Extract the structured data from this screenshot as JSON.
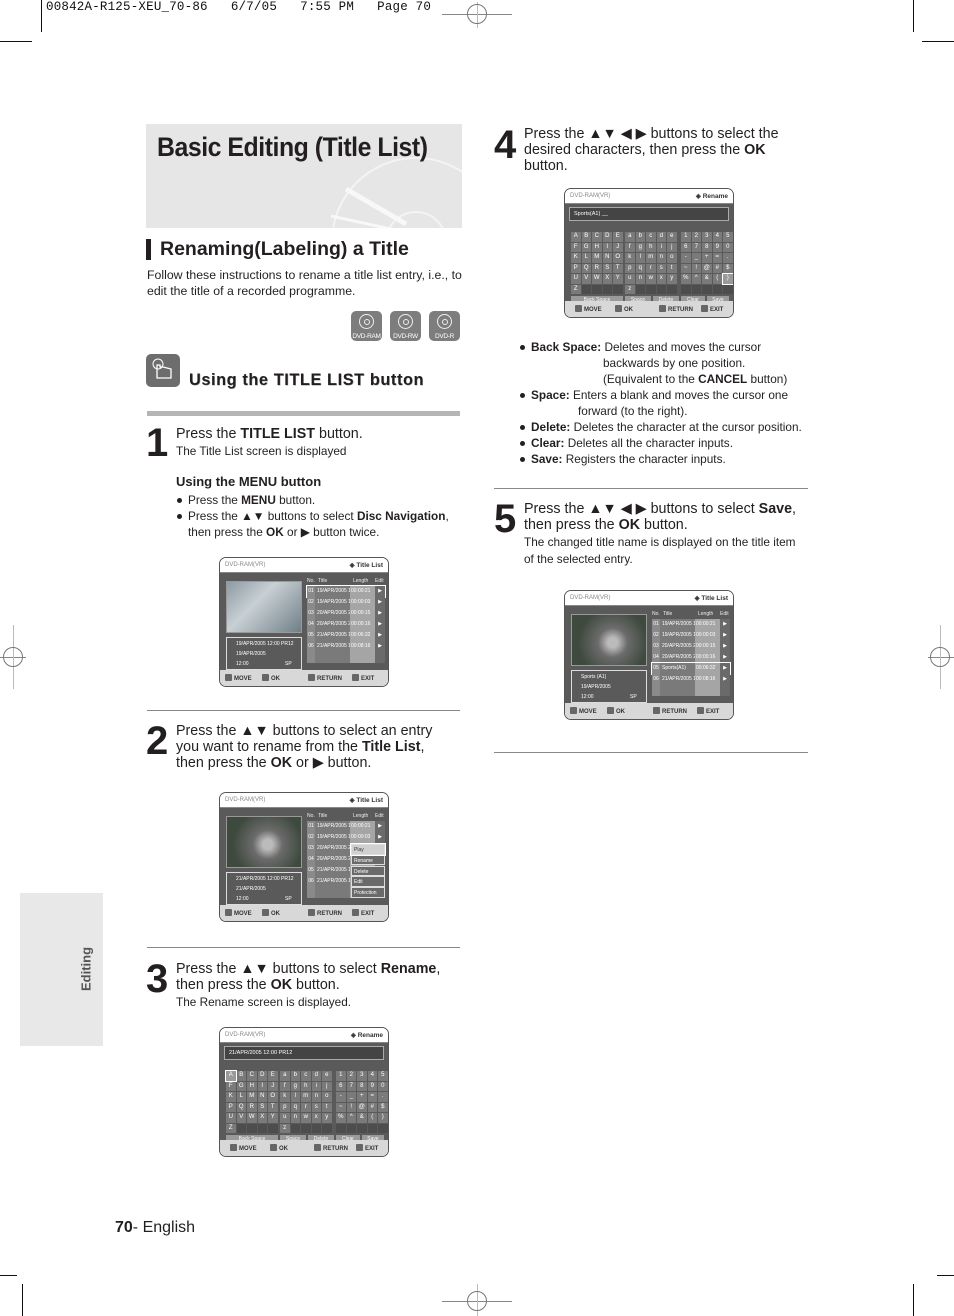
{
  "print_header": "00842A-R125-XEU_70-86   6/7/05   7:55 PM   Page 70",
  "page_title": "Basic Editing (Title List)",
  "section_title": "Renaming(Labeling) a Title",
  "intro": "Follow these instructions to rename a title list entry, i.e., to edit the title of a recorded programme.",
  "disc_types": [
    "DVD-RAM",
    "DVD-RW",
    "DVD-R"
  ],
  "using_header": "Using the TITLE LIST button",
  "side_tab": "Editing",
  "page_number": "70",
  "page_lang": "- English",
  "steps": [
    {
      "num": "1",
      "main_pre": "Press the ",
      "main_bold": "TITLE LIST",
      "main_post": " button.",
      "sub": "The Title List screen is displayed",
      "menu_header": "Using the MENU button",
      "bullets": [
        {
          "pre": "Press the ",
          "bold": "MENU",
          "post": " button."
        },
        {
          "pre": "Press the ▲▼ buttons to select ",
          "bold": "Disc Navigation",
          "post": ",",
          "line2_pre": "then press the ",
          "line2_bold": "OK",
          "line2_post": " or ▶ button twice."
        }
      ]
    },
    {
      "num": "2",
      "l1": "Press the ▲▼ buttons to select an entry",
      "l2_pre": "you want to rename from the ",
      "l2_bold": "Title List",
      "l2_post": ",",
      "l3_pre": "then press the ",
      "l3_bold": "OK",
      "l3_post": " or ▶ button."
    },
    {
      "num": "3",
      "l1_pre": "Press the ▲▼ buttons to select ",
      "l1_bold": "Rename",
      "l1_post": ",",
      "l2_pre": "then press the ",
      "l2_bold": "OK",
      "l2_post": " button.",
      "sub": "The Rename screen is displayed."
    },
    {
      "num": "4",
      "l1": "Press the ▲▼ ◀ ▶ buttons to select the",
      "l2_pre": "desired characters, then press the ",
      "l2_bold": "OK",
      "l3": "button.",
      "defs": [
        {
          "term": "Back Space:",
          "desc": "Deletes and moves the cursor",
          "desc2": "backwards by one position.",
          "desc3_pre": "(Equivalent to the ",
          "desc3_bold": "CANCEL",
          "desc3_post": " button)"
        },
        {
          "term": "Space:",
          "desc": " Enters a blank and moves the cursor one",
          "desc2": "forward (to the right)."
        },
        {
          "term": "Delete:",
          "desc": " Deletes the character at the cursor position."
        },
        {
          "term": "Clear:",
          "desc": " Deletes all the character inputs."
        },
        {
          "term": "Save:",
          "desc": " Registers the character inputs."
        }
      ]
    },
    {
      "num": "5",
      "l1_pre": "Press the ▲▼ ◀ ▶ buttons to select ",
      "l1_bold": "Save",
      "l1_post": ",",
      "l2_pre": "then press the ",
      "l2_bold": "OK",
      "l2_post": " button.",
      "sub1": "The changed title name is displayed on the title item",
      "sub2": "of the selected entry."
    }
  ],
  "screens": {
    "common": {
      "disc": "DVD-RAM(VR)",
      "title_list": "◈ Title List",
      "rename": "◈ Rename",
      "cols": {
        "no": "No.",
        "title": "Title",
        "length": "Length",
        "edit": "Edit"
      },
      "foot": {
        "move": "MOVE",
        "ok": "OK",
        "return": "RETURN",
        "exit": "EXIT"
      },
      "sp": "SP"
    },
    "s1": {
      "info": [
        "19/APR/2005 12:00 PR12",
        "19/APR/2005",
        "12:00"
      ],
      "rows": [
        [
          "01",
          "19/APR/2005 1",
          "00:00:21",
          "▶"
        ],
        [
          "02",
          "19/APR/2005 1",
          "00:00:03",
          "▶"
        ],
        [
          "03",
          "20/APR/2005 2",
          "00:00:15",
          "▶"
        ],
        [
          "04",
          "20/APR/2005 2",
          "00:00:16",
          "▶"
        ],
        [
          "05",
          "21/APR/2005 1",
          "00:06:32",
          "▶"
        ],
        [
          "06",
          "21/APR/2005 1",
          "00:08:16",
          "▶"
        ]
      ]
    },
    "s2": {
      "info": [
        "21/APR/2005 12:00 PR12",
        "21/APR/2005",
        "12:00"
      ],
      "rows": [
        [
          "01",
          "19/APR/2005 1",
          "00:00:21",
          "▶"
        ],
        [
          "02",
          "19/APR/2005 1",
          "00:00:03",
          "▶"
        ],
        [
          "03",
          "20/APR/2005 2",
          "",
          ""
        ],
        [
          "04",
          "20/APR/2005 2",
          "",
          ""
        ],
        [
          "05",
          "21/APR/2005 1",
          "",
          ""
        ],
        [
          "06",
          "21/APR/2005 1",
          "",
          ""
        ]
      ],
      "popup": [
        "Play",
        "Rename",
        "Delete",
        "Edit",
        "Protection"
      ]
    },
    "s3": {
      "field": "21/APR/2005 12:00 PR12"
    },
    "s4": {
      "field": "Sports(A1) __"
    },
    "keyboard": {
      "upper": [
        "A",
        "B",
        "C",
        "D",
        "E",
        "F",
        "G",
        "H",
        "I",
        "J",
        "K",
        "L",
        "M",
        "N",
        "O",
        "P",
        "Q",
        "R",
        "S",
        "T",
        "U",
        "V",
        "W",
        "X",
        "Y",
        "Z",
        "",
        "",
        "",
        ""
      ],
      "lower": [
        "a",
        "b",
        "c",
        "d",
        "e",
        "f",
        "g",
        "h",
        "i",
        "j",
        "k",
        "l",
        "m",
        "n",
        "o",
        "p",
        "q",
        "r",
        "s",
        "t",
        "u",
        "n",
        "w",
        "x",
        "y",
        "z",
        "",
        "",
        "",
        ""
      ],
      "nums": [
        "1",
        "2",
        "3",
        "4",
        "5",
        "6",
        "7",
        "8",
        "9",
        "0",
        "-",
        "_",
        "+",
        "=",
        ".",
        "~",
        "!",
        "@",
        "#",
        "$",
        "%",
        "^",
        "&",
        "(",
        ")",
        "",
        "",
        "",
        "",
        ""
      ],
      "buttons": [
        "Back Space",
        "Space",
        "Delete",
        "Clear",
        "Save"
      ]
    },
    "s5": {
      "info": [
        "Sports (A1)",
        "19/APR/2005",
        "12:00"
      ],
      "rows": [
        [
          "01",
          "19/APR/2005 1",
          "00:00:21",
          "▶"
        ],
        [
          "02",
          "19/APR/2005 1",
          "00:00:03",
          "▶"
        ],
        [
          "03",
          "20/APR/2005 2",
          "00:00:15",
          "▶"
        ],
        [
          "04",
          "20/APR/2005 2",
          "00:00:16",
          "▶"
        ],
        [
          "05",
          "Sports(A1)",
          "00:06:32",
          "▶"
        ],
        [
          "06",
          "21/APR/2005 1",
          "00:08:16",
          "▶"
        ]
      ]
    }
  }
}
